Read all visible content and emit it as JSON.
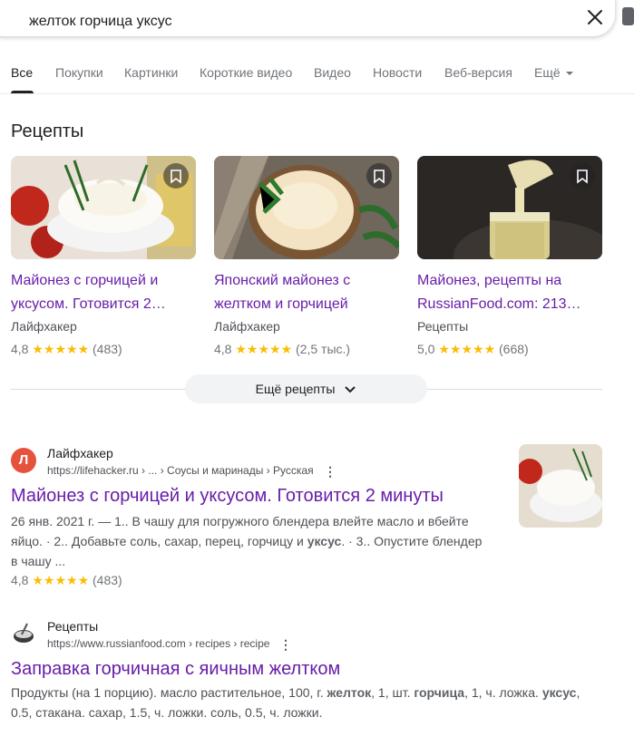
{
  "search": {
    "query": "желток горчица уксус"
  },
  "tabs": [
    {
      "label": "Все"
    },
    {
      "label": "Покупки"
    },
    {
      "label": "Картинки"
    },
    {
      "label": "Короткие видео"
    },
    {
      "label": "Видео"
    },
    {
      "label": "Новости"
    },
    {
      "label": "Веб-версия"
    },
    {
      "label": "Ещё"
    }
  ],
  "recipes": {
    "title": "Рецепты",
    "cards": [
      {
        "title": "Майонез с горчицей и уксусом. Готовится 2…",
        "source": "Лайфхакер",
        "rating": "4,8",
        "stars": "★★★★★",
        "count": "(483)"
      },
      {
        "title": "Японский майонез с желтком и горчицей",
        "source": "Лайфхакер",
        "rating": "4,8",
        "stars": "★★★★★",
        "count": "(2,5 тыс.)"
      },
      {
        "title": "Майонез, рецепты на RussianFood.com: 213…",
        "source": "Рецепты",
        "rating": "5,0",
        "stars": "★★★★★",
        "count": "(668)"
      }
    ],
    "more_label": "Ещё рецепты"
  },
  "results": [
    {
      "favicon_letter": "Л",
      "site": "Лайфхакер",
      "url": "https://lifehacker.ru › ... › Соусы и маринады › Русская",
      "title": "Майонез с горчицей и уксусом. Готовится 2 минуты",
      "snippet_a": "26 янв. 2021 г. — 1.. В чашу для погружного блендера влейте масло и вбейте яйцо. · 2.. Добавьте соль, сахар, перец, горчицу и ",
      "snippet_b": "уксус",
      "snippet_c": ". · 3.. Опустите блендер в чашу ...",
      "rating": "4,8",
      "stars": "★★★★★",
      "count": "(483)"
    },
    {
      "site": "Рецепты",
      "url": "https://www.russianfood.com › recipes › recipe",
      "title": "Заправка горчичная с яичным желтком",
      "s1": "Продукты (на 1 порцию). масло растительное, 100, г. ",
      "s2": "желток",
      "s3": ", 1, шт. ",
      "s4": "горчица",
      "s5": ", 1, ч. ложка. ",
      "s6": "уксус",
      "s7": ", 0.5, стакана. сахар, 1.5, ч. ложки. соль, 0.5, ч. ложки."
    }
  ],
  "colors": {
    "link_visited": "#681da8",
    "star": "#fbbc04",
    "favicon_red": "#e5533d"
  }
}
